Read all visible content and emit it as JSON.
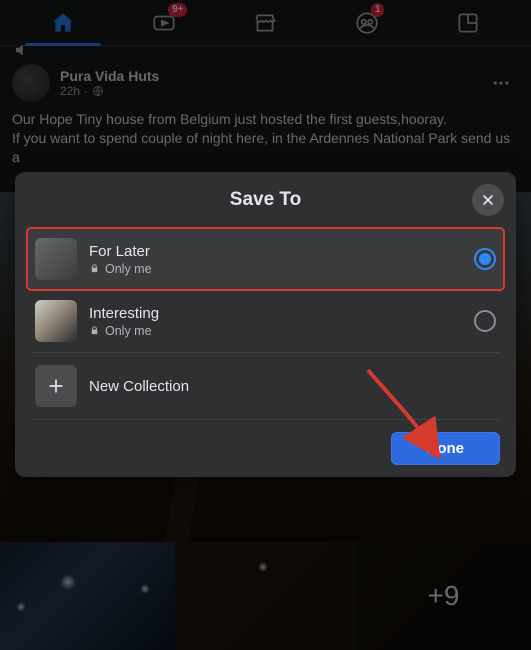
{
  "nav": {
    "badge_watch": "9+",
    "badge_groups": "1"
  },
  "post": {
    "author": "Pura Vida Huts",
    "time": "22h",
    "text_line1": "Our Hope Tiny house from Belgium just hosted the first guests,hooray.",
    "text_line2": "If you want to spend couple of night here, in the Ardennes National Park send us a"
  },
  "gallery": {
    "more": "+9"
  },
  "modal": {
    "title": "Save To",
    "collections": [
      {
        "name": "For Later",
        "privacy": "Only me",
        "selected": true
      },
      {
        "name": "Interesting",
        "privacy": "Only me",
        "selected": false
      }
    ],
    "new_label": "New Collection",
    "done": "Done"
  }
}
